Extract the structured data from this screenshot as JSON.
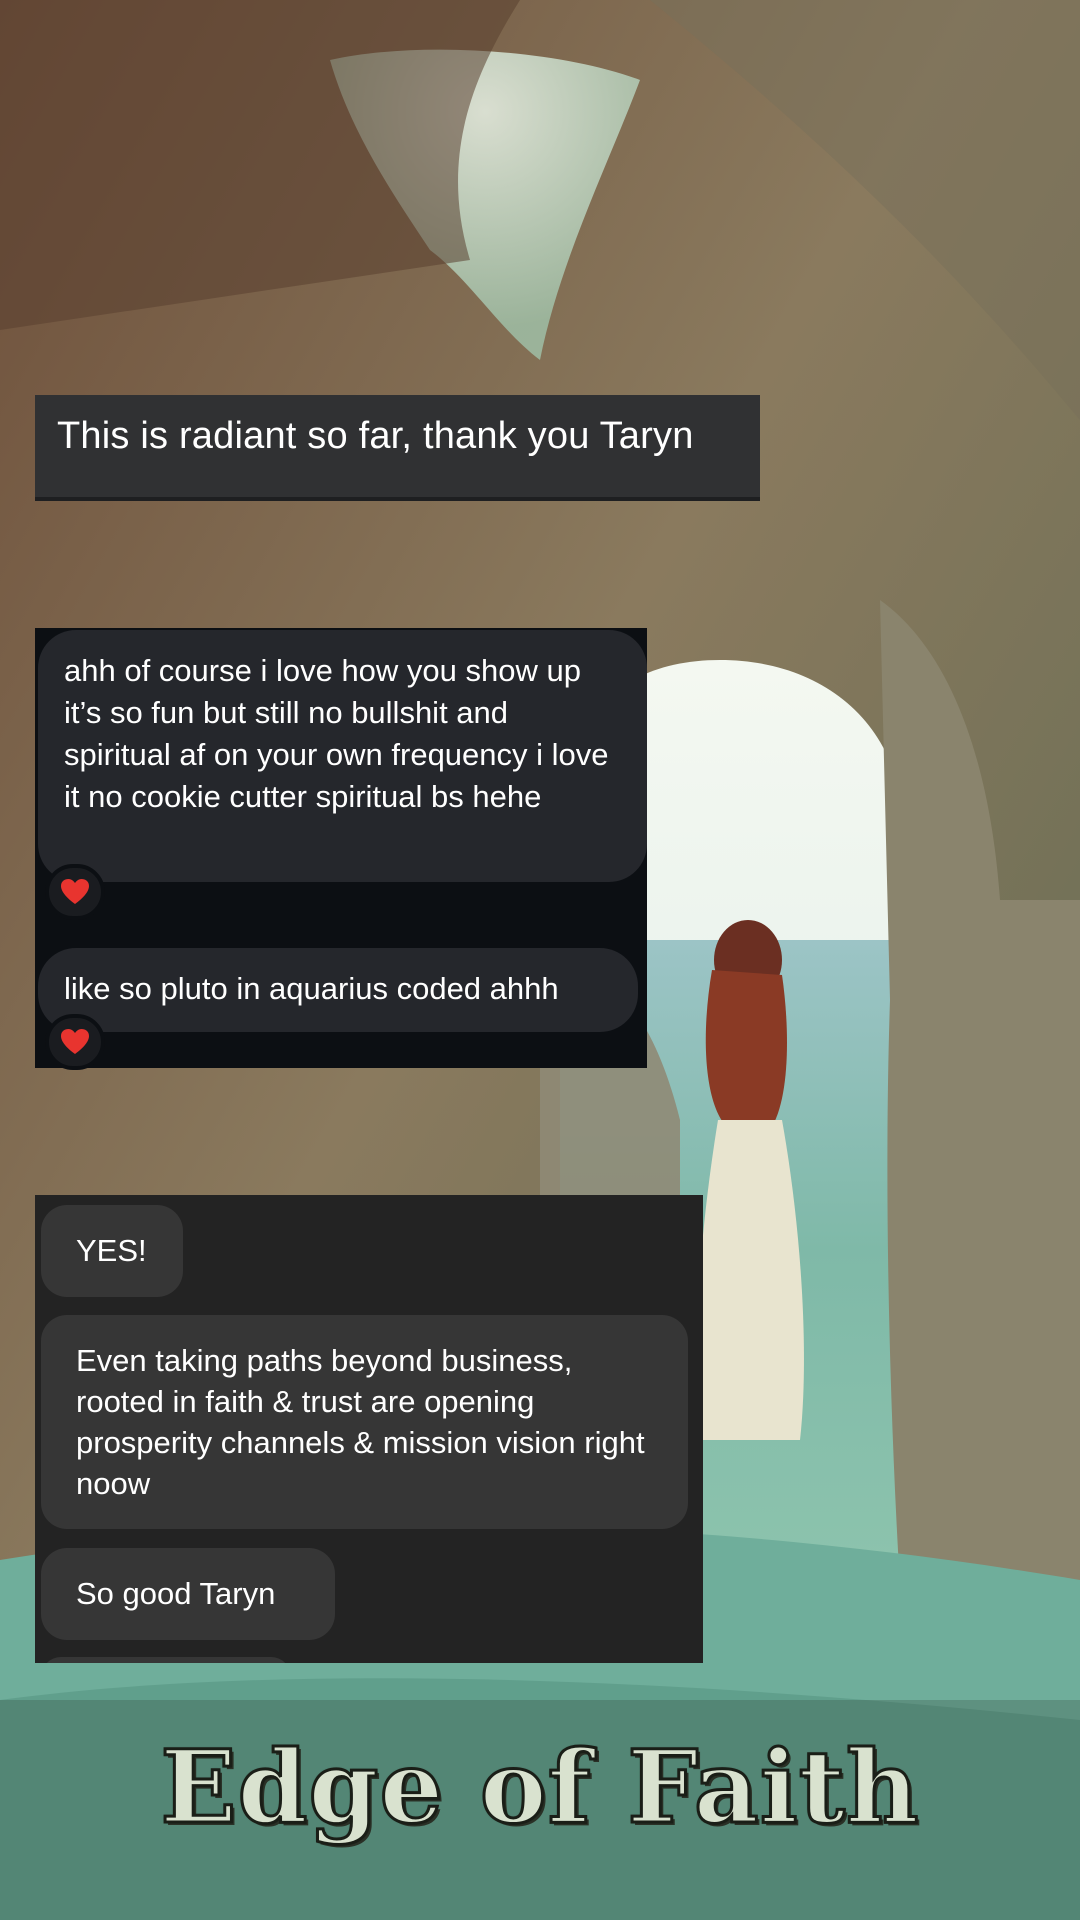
{
  "card1": {
    "message": "This is radiant so far, thank you Taryn"
  },
  "card2": {
    "messages": [
      {
        "text": "ahh of course i love how you show up it’s so fun but still no bullshit and spiritual af on your own frequency i love it no cookie cutter spiritual bs hehe",
        "reaction": "❤️"
      },
      {
        "text": "like so pluto in aquarius coded ahhh",
        "reaction": "❤️"
      }
    ]
  },
  "card3": {
    "messages": [
      {
        "text": "YES!"
      },
      {
        "text": "Even taking paths beyond business, rooted in faith & trust are opening prosperity channels & mission vision right noow"
      },
      {
        "text": "So good Taryn"
      }
    ]
  },
  "title": "Edge of Faith",
  "colors": {
    "bubble_dark": "#25272c",
    "bubble_gray": "#363636",
    "heart": "#e8342f",
    "sea": "#7fb9a8"
  }
}
